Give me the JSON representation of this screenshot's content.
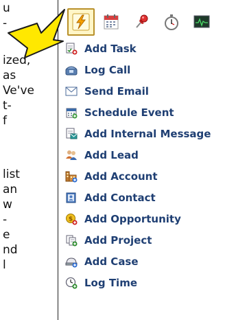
{
  "article": {
    "lines": [
      "u",
      "-",
      "",
      "ized,",
      "as",
      "Ve've",
      "t-",
      "f",
      "",
      "list",
      "an",
      "w",
      "-",
      "e",
      "nd",
      "l"
    ]
  },
  "toolbar": {
    "items": [
      {
        "icon": "lightning-icon",
        "active": true
      },
      {
        "icon": "calendar-icon",
        "active": false
      },
      {
        "icon": "pushpin-icon",
        "active": false
      },
      {
        "icon": "stopwatch-icon",
        "active": false
      },
      {
        "icon": "activity-monitor-icon",
        "active": false
      }
    ]
  },
  "menu": {
    "items": [
      {
        "label": "Add Task",
        "icon": "add-task-icon"
      },
      {
        "label": "Log Call",
        "icon": "log-call-icon"
      },
      {
        "label": "Send Email",
        "icon": "send-email-icon"
      },
      {
        "label": "Schedule Event",
        "icon": "schedule-event-icon"
      },
      {
        "label": "Add Internal Message",
        "icon": "add-internal-message-icon"
      },
      {
        "label": "Add Lead",
        "icon": "add-lead-icon"
      },
      {
        "label": "Add Account",
        "icon": "add-account-icon"
      },
      {
        "label": "Add Contact",
        "icon": "add-contact-icon"
      },
      {
        "label": "Add Opportunity",
        "icon": "add-opportunity-icon"
      },
      {
        "label": "Add Project",
        "icon": "add-project-icon"
      },
      {
        "label": "Add Case",
        "icon": "add-case-icon"
      },
      {
        "label": "Log Time",
        "icon": "log-time-icon"
      }
    ]
  },
  "colors": {
    "menu_text": "#1f3f73",
    "arrow_fill": "#ffe800",
    "active_bg": "#fff6c8"
  }
}
